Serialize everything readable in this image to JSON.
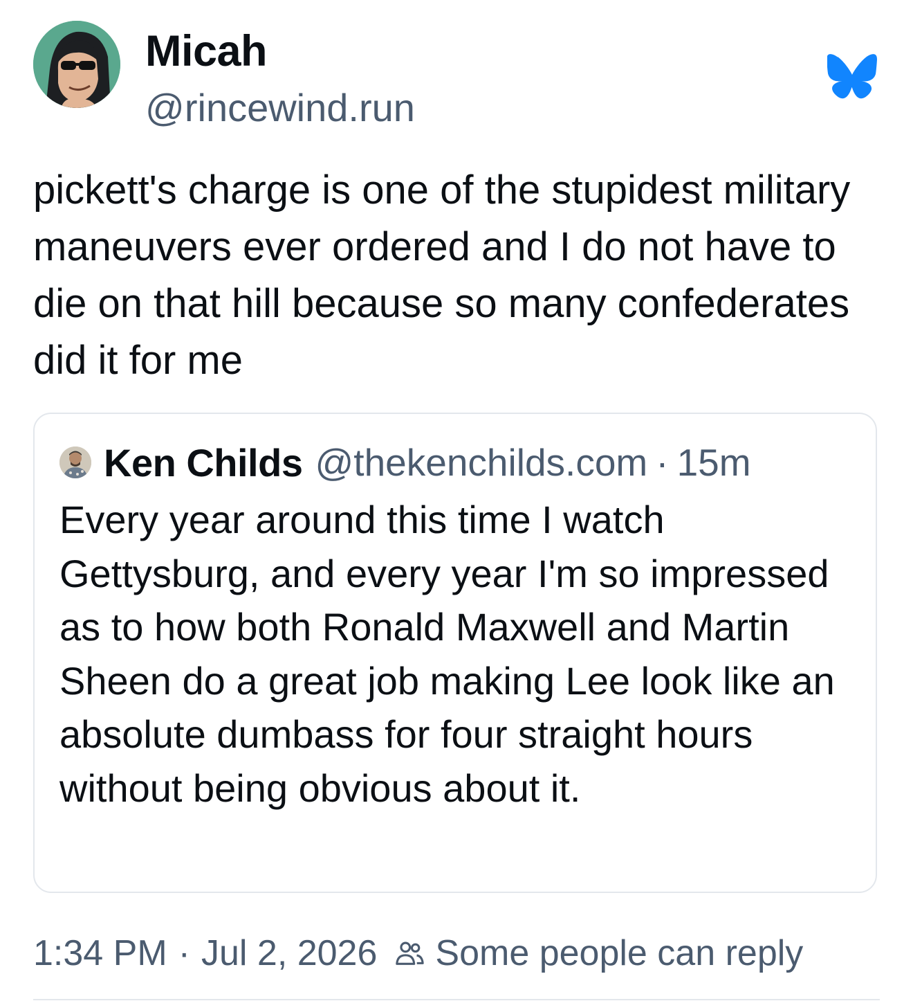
{
  "post": {
    "author": {
      "display_name": "Micah",
      "handle": "@rincewind.run",
      "avatar_icon": "cartoon-avatar"
    },
    "service_icon": "bluesky-butterfly-icon",
    "accent_color": "#1185fe",
    "text": "pickett's charge is one of the stupidest military maneuvers ever ordered and I do not have to die on that hill because so many confederates did it for me",
    "quoted_post": {
      "author": {
        "display_name": "Ken Childs",
        "handle": "@thekenchilds.com",
        "avatar_icon": "photo-avatar"
      },
      "separator": "·",
      "relative_time": "15m",
      "text": "Every year around this time I watch Gettysburg, and every year I'm so impressed as to how both Ronald Maxwell and Martin Sheen do a great job making Lee look like an absolute dumbass for four straight hours without being obvious about it."
    },
    "footer": {
      "time": "1:34 PM",
      "separator": "·",
      "date": "Jul 2, 2026",
      "reply_icon": "people-icon",
      "reply_setting": "Some people can reply"
    }
  }
}
